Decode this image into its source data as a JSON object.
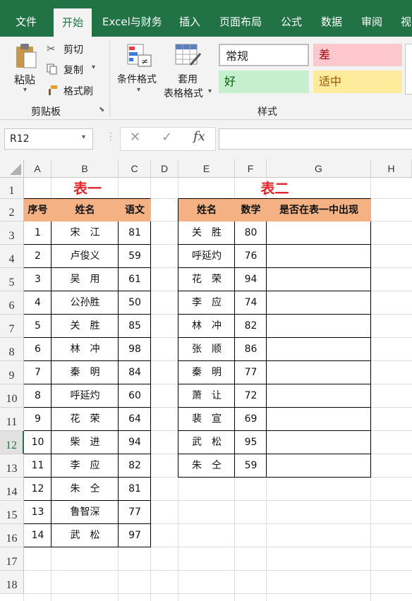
{
  "tabs": [
    "文件",
    "开始",
    "Excel与财务",
    "插入",
    "页面布局",
    "公式",
    "数据",
    "审阅",
    "视"
  ],
  "clipboard": {
    "paste": "粘贴",
    "cut": "剪切",
    "copy": "复制",
    "format_painter": "格式刷",
    "group": "剪贴板"
  },
  "styles": {
    "cond_format": "条件格式",
    "table_format_1": "套用",
    "table_format_2": "表格格式",
    "normal": "常规",
    "bad": "差",
    "good": "好",
    "neutral": "适中",
    "group": "样式"
  },
  "formula_bar": {
    "name_box": "R12",
    "fx": "fx"
  },
  "columns": [
    "A",
    "B",
    "C",
    "D",
    "E",
    "F",
    "G",
    "H"
  ],
  "rows": [
    "1",
    "2",
    "3",
    "4",
    "5",
    "6",
    "7",
    "8",
    "9",
    "10",
    "11",
    "12",
    "13",
    "14",
    "15",
    "16",
    "17",
    "18"
  ],
  "table1": {
    "title": "表一",
    "headers": [
      "序号",
      "姓名",
      "语文"
    ],
    "rows": [
      [
        "1",
        "宋　江",
        "81"
      ],
      [
        "2",
        "卢俊义",
        "59"
      ],
      [
        "3",
        "吴　用",
        "61"
      ],
      [
        "4",
        "公孙胜",
        "50"
      ],
      [
        "5",
        "关　胜",
        "85"
      ],
      [
        "6",
        "林　冲",
        "98"
      ],
      [
        "7",
        "秦　明",
        "84"
      ],
      [
        "8",
        "呼延灼",
        "60"
      ],
      [
        "9",
        "花　荣",
        "64"
      ],
      [
        "10",
        "柴　进",
        "94"
      ],
      [
        "11",
        "李　应",
        "82"
      ],
      [
        "12",
        "朱　仝",
        "81"
      ],
      [
        "13",
        "鲁智深",
        "77"
      ],
      [
        "14",
        "武　松",
        "97"
      ]
    ]
  },
  "table2": {
    "title": "表二",
    "headers": [
      "姓名",
      "数学",
      "是否在表一中出现"
    ],
    "rows": [
      [
        "关　胜",
        "80",
        ""
      ],
      [
        "呼延灼",
        "76",
        ""
      ],
      [
        "花　荣",
        "94",
        ""
      ],
      [
        "李　应",
        "74",
        ""
      ],
      [
        "林　冲",
        "82",
        ""
      ],
      [
        "张　顺",
        "86",
        ""
      ],
      [
        "秦　明",
        "77",
        ""
      ],
      [
        "萧　让",
        "72",
        ""
      ],
      [
        "裴　宣",
        "69",
        ""
      ],
      [
        "武　松",
        "95",
        ""
      ],
      [
        "朱　仝",
        "59",
        ""
      ]
    ]
  },
  "colors": {
    "brand": "#217346",
    "header_fill": "#f4b183",
    "title": "#e0262a"
  }
}
